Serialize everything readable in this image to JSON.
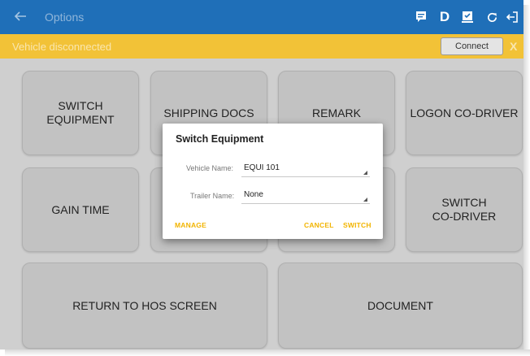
{
  "app": {
    "title": "Options"
  },
  "toolbar": {
    "icons": [
      "back-arrow-icon",
      "chat-icon",
      "d-indicator",
      "inspection-icon",
      "sync-icon",
      "logout-icon"
    ],
    "d_label": "D"
  },
  "banner": {
    "text": "Vehicle disconnected",
    "connect_label": "Connect",
    "close_label": "X"
  },
  "tiles": [
    {
      "label": "SWITCH EQUIPMENT"
    },
    {
      "label": "SHIPPING DOCS"
    },
    {
      "label": "REMARK"
    },
    {
      "label": "LOGON CO-DRIVER"
    },
    {
      "label": "GAIN TIME"
    },
    {
      "label": ""
    },
    {
      "label": ""
    },
    {
      "label": "SWITCH CO-DRIVER"
    },
    {
      "label": "RETURN TO HOS SCREEN"
    },
    {
      "label": "DOCUMENT"
    }
  ],
  "dialog": {
    "title": "Switch Equipment",
    "vehicle_label": "Vehicle Name:",
    "vehicle_value": "EQUI 101",
    "trailer_label": "Trailer Name:",
    "trailer_value": "None",
    "manage_label": "MANAGE",
    "cancel_label": "CANCEL",
    "switch_label": "SWITCH"
  },
  "colors": {
    "topbar": "#1f6fb8",
    "banner": "#f2c237",
    "accent": "#f2b400",
    "backdrop": "#cfcfcf"
  }
}
